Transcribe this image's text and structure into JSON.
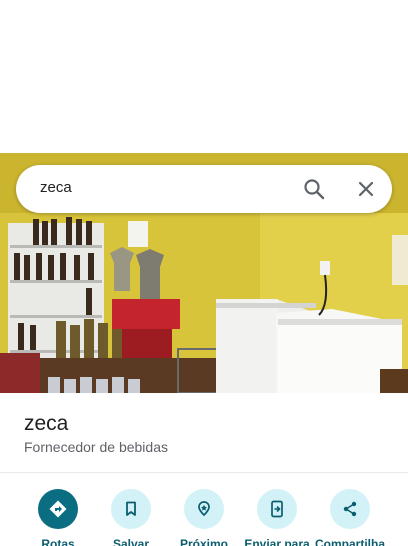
{
  "search": {
    "query": "zeca"
  },
  "place": {
    "name": "zeca",
    "category": "Fornecedor de bebidas"
  },
  "actions": [
    {
      "label": "Rotas",
      "icon": "directions-icon"
    },
    {
      "label": "Salvar",
      "icon": "bookmark-icon"
    },
    {
      "label": "Próximo",
      "icon": "nearby-icon"
    },
    {
      "label": "Enviar para",
      "icon": "send-to-phone-icon"
    },
    {
      "label": "Compartilha",
      "icon": "share-icon"
    }
  ],
  "colors": {
    "accent": "#0b6d82",
    "action_bg": "#d2f2f8",
    "label": "#0b5e6f"
  }
}
